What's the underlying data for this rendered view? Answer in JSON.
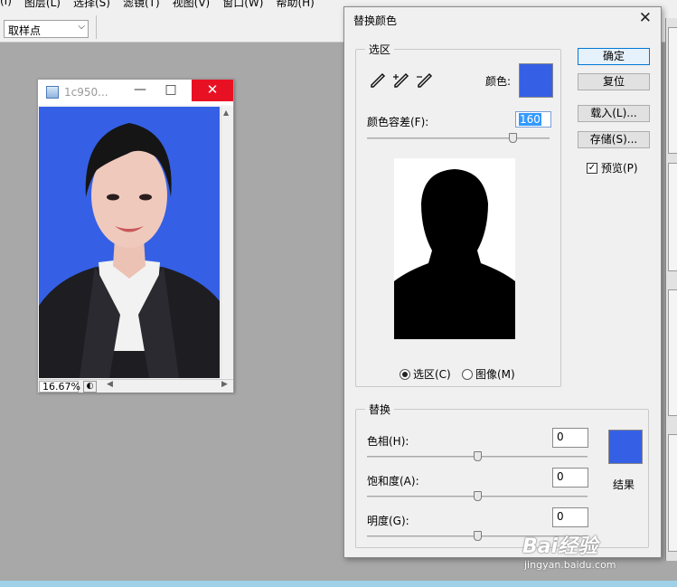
{
  "menubar": {
    "items": [
      "(I)",
      "图层(L)",
      "选择(S)",
      "滤镜(T)",
      "视图(V)",
      "窗口(W)",
      "帮助(H)"
    ]
  },
  "options": {
    "sampler_value": "取样点"
  },
  "document": {
    "title": "1c950...",
    "zoom": "16.67%"
  },
  "dialog": {
    "title": "替换颜色",
    "selection": {
      "group_label": "选区",
      "color_label": "颜色:",
      "color": "#3560e5",
      "tolerance_label": "颜色容差(F):",
      "tolerance_value": "160",
      "tolerance_fraction": 0.8,
      "radio_selection": "选区(C)",
      "radio_image": "图像(M)",
      "selected_radio": "selection"
    },
    "buttons": {
      "ok": "确定",
      "reset": "复位",
      "load": "载入(L)...",
      "save": "存储(S)..."
    },
    "preview": {
      "label": "预览(P)",
      "checked": true
    },
    "replace": {
      "group_label": "替换",
      "hue_label": "色相(H):",
      "hue_value": "0",
      "saturation_label": "饱和度(A):",
      "saturation_value": "0",
      "lightness_label": "明度(G):",
      "lightness_value": "0",
      "result_label": "结果",
      "result_color": "#3560e5"
    }
  },
  "watermark": {
    "line1": "Bai经验",
    "line2": "jingyan.baidu.com"
  }
}
